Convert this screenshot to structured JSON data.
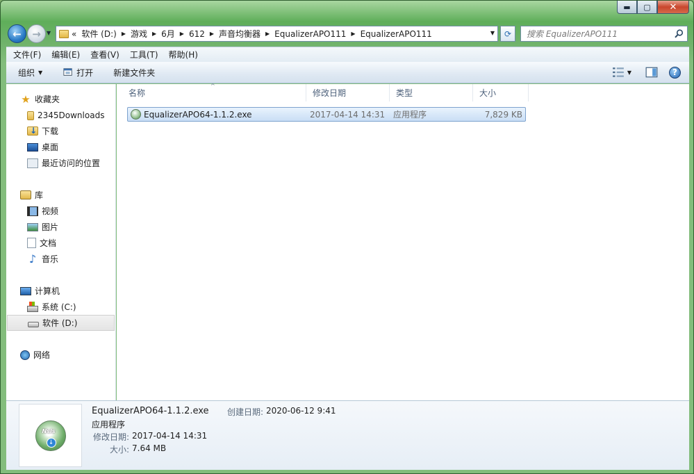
{
  "window": {
    "controls": {
      "minimize": "▬",
      "maximize": "▢",
      "close": "✕"
    }
  },
  "nav": {
    "back_glyph": "←",
    "forward_glyph": "→",
    "history_glyph": "▼"
  },
  "address": {
    "prefix": "«",
    "crumbs": [
      "软件 (D:)",
      "游戏",
      "6月",
      "612",
      "声音均衡器",
      "EqualizerAPO111",
      "EqualizerAPO111"
    ],
    "dropdown_glyph": "▼",
    "refresh_glyph": "⟳"
  },
  "search": {
    "placeholder": "搜索 EqualizerAPO111"
  },
  "menu": [
    "文件(F)",
    "编辑(E)",
    "查看(V)",
    "工具(T)",
    "帮助(H)"
  ],
  "toolbar": {
    "organize": "组织",
    "open": "打开",
    "new_folder": "新建文件夹",
    "dropdown_glyph": "▼",
    "help_glyph": "?"
  },
  "sidebar": {
    "favorites": {
      "label": "收藏夹",
      "items": [
        "2345Downloads",
        "下载",
        "桌面",
        "最近访问的位置"
      ]
    },
    "libraries": {
      "label": "库",
      "items": [
        "视频",
        "图片",
        "文档",
        "音乐"
      ]
    },
    "computer": {
      "label": "计算机",
      "items": [
        "系统 (C:)",
        "软件 (D:)"
      ],
      "selected": "软件 (D:)"
    },
    "network": {
      "label": "网络"
    }
  },
  "columns": {
    "name": "名称",
    "date": "修改日期",
    "type": "类型",
    "size": "大小",
    "sort_glyph": "^"
  },
  "files": [
    {
      "name": "EqualizerAPO64-1.1.2.exe",
      "date": "2017-04-14 14:31",
      "type": "应用程序",
      "size": "7,829 KB",
      "selected": true
    }
  ],
  "details": {
    "filename": "EqualizerAPO64-1.1.2.exe",
    "type": "应用程序",
    "modified_label": "修改日期:",
    "modified_value": "2017-04-14 14:31",
    "size_label": "大小:",
    "size_value": "7.64 MB",
    "created_label": "创建日期:",
    "created_value": "2020-06-12 9:41",
    "thumb_logo": "Nsis",
    "thumb_arrow": "↓"
  },
  "colors": {
    "selection_bg": "#cce0f6",
    "selection_border": "#7da2ce",
    "window_frame": "#6fb26a"
  }
}
